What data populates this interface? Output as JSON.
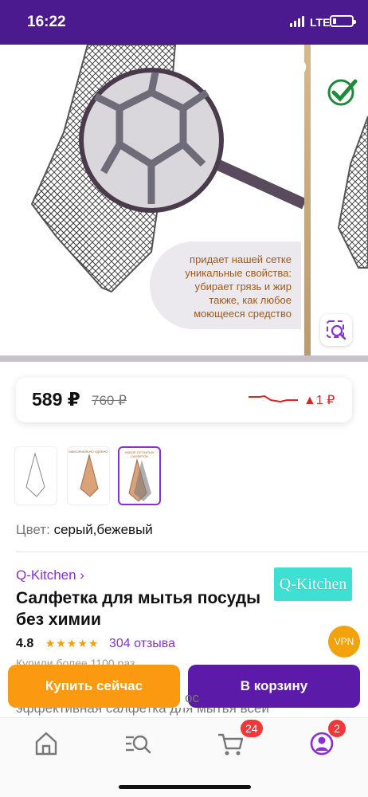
{
  "status_bar": {
    "time": "16:22",
    "network": "LTE"
  },
  "gallery": {
    "promo_text": "придает нашей сетке уникальные свойства: убирает грязь и жир также, как любое моющееся средство"
  },
  "price_card": {
    "price": "589 ₽",
    "old_price": "760 ₽",
    "price_change": "▲1 ₽",
    "trend_color": "#e02424"
  },
  "thumbnails": [
    {
      "caption": "",
      "selected": false
    },
    {
      "caption": "МАКСИМАЛЬНО УДОБНО",
      "selected": false
    },
    {
      "caption": "НАБОР СЕТЧАТЫХ САЛФЕТОК",
      "selected": true
    }
  ],
  "color": {
    "label": "Цвет:",
    "value": "серый,бежевый"
  },
  "product": {
    "brand": "Q-Kitchen ›",
    "brand_logo": "Q-Kitchen",
    "title": "Салфетка для мытья посуды без химии",
    "rating": "4.8",
    "stars": "★★★★★",
    "reviews": "304 отзыва",
    "bought": "Купили более 1100 раз",
    "description": "эффективная салфетка для мытья всей",
    "partial_description": "ос"
  },
  "vpn_badge": "VPN",
  "actions": {
    "buy_now": "Купить сейчас",
    "add_to_cart": "В корзину"
  },
  "tabbar": {
    "cart_count": "24",
    "profile_count": "2"
  },
  "colors": {
    "brand_purple": "#4b1a8e",
    "cart_button": "#5c1aa8",
    "buy_button": "#fb9a10",
    "link": "#8a2fd6"
  }
}
